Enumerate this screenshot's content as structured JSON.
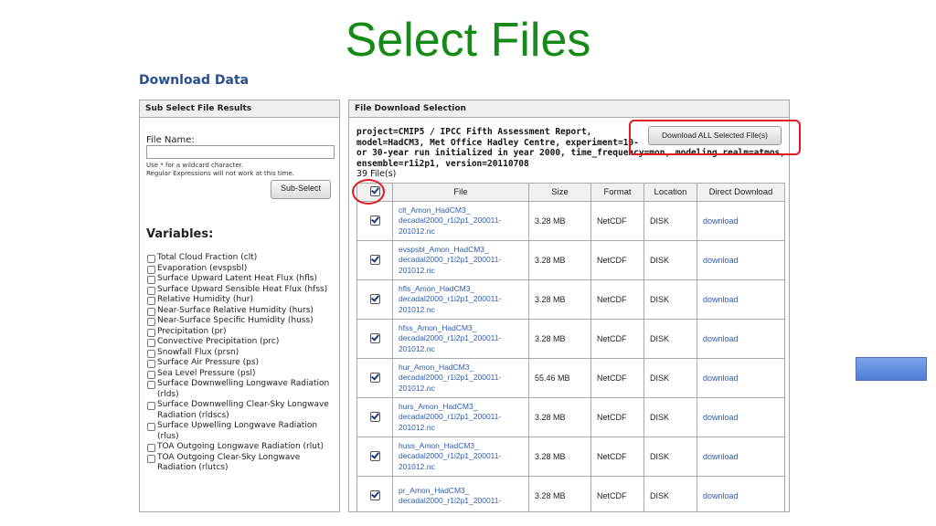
{
  "slide_title": "Select Files",
  "download_heading": "Download Data",
  "left_panel": {
    "header": "Sub Select File Results",
    "file_name_label": "File Name:",
    "file_name_value": "",
    "hint_lines": [
      "Use * for a wildcard character.",
      "Regular Expressions will not work at this time."
    ],
    "sub_select_button": "Sub-Select",
    "variables_title": "Variables:",
    "variables": [
      "Total Cloud Fraction (clt)",
      "Evaporation (evspsbl)",
      "Surface Upward Latent Heat Flux (hfls)",
      "Surface Upward Sensible Heat Flux (hfss)",
      "Relative Humidity (hur)",
      "Near-Surface Relative Humidity (hurs)",
      "Near-Surface Specific Humidity (huss)",
      "Precipitation (pr)",
      "Convective Precipitation (prc)",
      "Snowfall Flux (prsn)",
      "Surface Air Pressure (ps)",
      "Sea Level Pressure (psl)",
      "Surface Downwelling Longwave Radiation (rlds)",
      "Surface Downwelling Clear-Sky Longwave Radiation (rldscs)",
      "Surface Upwelling Longwave Radiation (rlus)",
      "TOA Outgoing Longwave Radiation (rlut)",
      "TOA Outgoing Clear-Sky Longwave Radiation (rlutcs)"
    ]
  },
  "right_panel": {
    "header": "File Download Selection",
    "query_lines": [
      "project=CMIP5 / IPCC Fifth Assessment Report,",
      "model=HadCM3, Met Office Hadley Centre, experiment=10-",
      "or 30-year run initialized in year 2000, time_frequency=mon, modeling realm=atmos,",
      "ensemble=r1i2p1, version=20110708"
    ],
    "file_count": "39 File(s)",
    "download_all_button": "Download ALL Selected File(s)",
    "columns": [
      "File",
      "Size",
      "Format",
      "Location",
      "Direct Download"
    ],
    "rows": [
      {
        "file_lines": [
          "clt_Amon_HadCM3_",
          "decadal2000_r1i2p1_200011-",
          "201012.nc"
        ],
        "size": "3.28 MB",
        "format": "NetCDF",
        "location": "DISK",
        "download": "download"
      },
      {
        "file_lines": [
          "evspsbl_Amon_HadCM3_",
          "decadal2000_r1i2p1_200011-",
          "201012.nc"
        ],
        "size": "3.28 MB",
        "format": "NetCDF",
        "location": "DISK",
        "download": "download"
      },
      {
        "file_lines": [
          "hfls_Amon_HadCM3_",
          "decadal2000_r1i2p1_200011-",
          "201012.nc"
        ],
        "size": "3.28 MB",
        "format": "NetCDF",
        "location": "DISK",
        "download": "download"
      },
      {
        "file_lines": [
          "hfss_Amon_HadCM3_",
          "decadal2000_r1i2p1_200011-",
          "201012.nc"
        ],
        "size": "3.28 MB",
        "format": "NetCDF",
        "location": "DISK",
        "download": "download"
      },
      {
        "file_lines": [
          "hur_Amon_HadCM3_",
          "decadal2000_r1i2p1_200011-",
          "201012.nc"
        ],
        "size": "55.46 MB",
        "format": "NetCDF",
        "location": "DISK",
        "download": "download"
      },
      {
        "file_lines": [
          "hurs_Amon_HadCM3_",
          "decadal2000_r1i2p1_200011-",
          "201012.nc"
        ],
        "size": "3.28 MB",
        "format": "NetCDF",
        "location": "DISK",
        "download": "download"
      },
      {
        "file_lines": [
          "huss_Amon_HadCM3_",
          "decadal2000_r1i2p1_200011-",
          "201012.nc"
        ],
        "size": "3.28 MB",
        "format": "NetCDF",
        "location": "DISK",
        "download": "download"
      },
      {
        "file_lines": [
          "pr_Amon_HadCM3_",
          "decadal2000_r1i2p1_200011-",
          ""
        ],
        "size": "3.28 MB",
        "format": "NetCDF",
        "location": "DISK",
        "download": "download"
      }
    ]
  },
  "colors": {
    "title_green": "#168a16",
    "heading_blue": "#2a4f8f",
    "link_blue": "#2a5db0",
    "highlight_red": "#e0191e",
    "side_shape_blue": "#5b89dc"
  }
}
